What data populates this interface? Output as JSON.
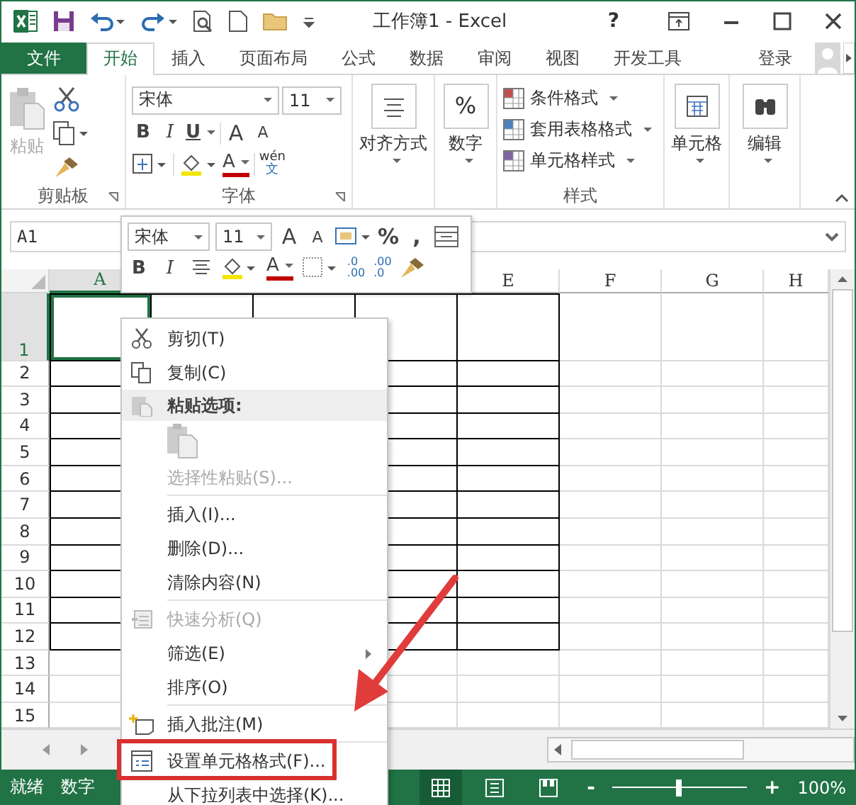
{
  "title_bar": {
    "title": "工作簿1 - Excel",
    "help": "?"
  },
  "tabs": [
    {
      "label": "文件",
      "kind": "file",
      "selected": false
    },
    {
      "label": "开始",
      "kind": "tab",
      "selected": true
    },
    {
      "label": "插入",
      "kind": "tab",
      "selected": false
    },
    {
      "label": "页面布局",
      "kind": "tab",
      "selected": false
    },
    {
      "label": "公式",
      "kind": "tab",
      "selected": false
    },
    {
      "label": "数据",
      "kind": "tab",
      "selected": false
    },
    {
      "label": "审阅",
      "kind": "tab",
      "selected": false
    },
    {
      "label": "视图",
      "kind": "tab",
      "selected": false
    },
    {
      "label": "开发工具",
      "kind": "tab",
      "selected": false
    },
    {
      "label": "登录",
      "kind": "signin",
      "selected": false
    }
  ],
  "ribbon": {
    "clipboard": {
      "paste": "粘贴",
      "label": "剪贴板"
    },
    "font": {
      "font_name": "宋体",
      "font_size": "11",
      "bold": "B",
      "italic": "I",
      "underline": "U",
      "grow": "A",
      "shrink": "A",
      "font_color": "A",
      "phonetic_top": "wén",
      "phonetic_bottom": "文",
      "label": "字体"
    },
    "alignment": {
      "label": "对齐方式"
    },
    "number": {
      "symbol": "%",
      "label": "数字"
    },
    "styles": {
      "items": [
        "条件格式",
        "套用表格格式",
        "单元格样式"
      ],
      "label": "样式"
    },
    "cells": {
      "label": "单元格"
    },
    "editing": {
      "label": "编辑"
    }
  },
  "formula_bar": {
    "name_box": "A1"
  },
  "sheet": {
    "columns": [
      {
        "label": "A",
        "selected": true,
        "bordered": true
      },
      {
        "bordered": true
      },
      {
        "bordered": true
      },
      {
        "bordered": true
      },
      {
        "label": "E",
        "selected": false,
        "bordered": true
      },
      {
        "label": "F",
        "selected": false,
        "bordered": false
      },
      {
        "label": "G",
        "selected": false,
        "bordered": false
      },
      {
        "label": "H",
        "selected": false,
        "bordered": false
      }
    ],
    "rows": [
      {
        "label": "1",
        "selected": true,
        "bordered": true
      },
      {
        "label": "2",
        "selected": false,
        "bordered": true
      },
      {
        "label": "3",
        "selected": false,
        "bordered": true
      },
      {
        "label": "4",
        "selected": false,
        "bordered": true
      },
      {
        "label": "5",
        "selected": false,
        "bordered": true
      },
      {
        "label": "6",
        "selected": false,
        "bordered": true
      },
      {
        "label": "7",
        "selected": false,
        "bordered": true
      },
      {
        "label": "8",
        "selected": false,
        "bordered": true
      },
      {
        "label": "9",
        "selected": false,
        "bordered": true
      },
      {
        "label": "10",
        "selected": false,
        "bordered": true
      },
      {
        "label": "11",
        "selected": false,
        "bordered": true
      },
      {
        "label": "12",
        "selected": false,
        "bordered": true
      },
      {
        "label": "13",
        "selected": false,
        "bordered": false
      },
      {
        "label": "14",
        "selected": false,
        "bordered": false
      },
      {
        "label": "15",
        "selected": false,
        "bordered": false
      }
    ]
  },
  "mini_toolbar": {
    "font_name": "宋体",
    "font_size": "11",
    "grow": "A",
    "shrink": "A",
    "percent": "%",
    "comma": ",",
    "bold": "B",
    "italic": "I",
    "font_color": "A",
    "increase_decimal": {
      "top": ".0",
      "bottom": ".00"
    },
    "decrease_decimal": {
      "top": ".00",
      "bottom": ".0"
    }
  },
  "context_menu": [
    {
      "kind": "item",
      "label": "剪切(T)",
      "disabled": false,
      "submenu": false
    },
    {
      "kind": "item",
      "label": "复制(C)",
      "disabled": false,
      "submenu": false
    },
    {
      "kind": "header",
      "label": "粘贴选项:"
    },
    {
      "kind": "paste_option"
    },
    {
      "kind": "item",
      "label": "选择性粘贴(S)...",
      "disabled": true,
      "submenu": false
    },
    {
      "kind": "separator"
    },
    {
      "kind": "item",
      "label": "插入(I)...",
      "disabled": false,
      "submenu": false
    },
    {
      "kind": "item",
      "label": "删除(D)...",
      "disabled": false,
      "submenu": false
    },
    {
      "kind": "item",
      "label": "清除内容(N)",
      "disabled": false,
      "submenu": false
    },
    {
      "kind": "separator"
    },
    {
      "kind": "item",
      "label": "快速分析(Q)",
      "disabled": true,
      "submenu": false
    },
    {
      "kind": "item",
      "label": "筛选(E)",
      "disabled": false,
      "submenu": true
    },
    {
      "kind": "item",
      "label": "排序(O)",
      "disabled": false
    },
    {
      "kind": "separator"
    },
    {
      "kind": "item",
      "label": "插入批注(M)",
      "disabled": false,
      "submenu": false
    },
    {
      "kind": "separator"
    },
    {
      "kind": "item",
      "label": "设置单元格格式(F)...",
      "disabled": false,
      "submenu": false
    },
    {
      "kind": "item",
      "label": "从下拉列表中选择(K)...",
      "disabled": false,
      "submenu": false
    }
  ],
  "status_bar": {
    "left": [
      "就绪",
      "数字"
    ],
    "views": [
      {
        "kind": "normal",
        "selected": true
      },
      {
        "kind": "page_layout",
        "selected": false
      },
      {
        "kind": "page_break",
        "selected": false
      }
    ],
    "zoom_out": "-",
    "zoom_in": "+",
    "zoom": {
      "level": 0.5
    },
    "zoom_text": "100%"
  }
}
